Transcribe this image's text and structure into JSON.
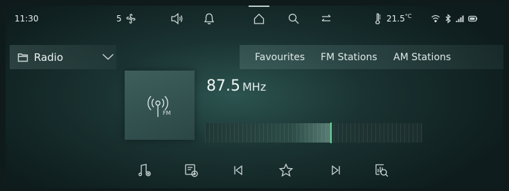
{
  "status_bar": {
    "time": "11:30",
    "fan_level": "5",
    "temperature": "21.5",
    "temperature_unit": "°C",
    "icons": [
      "fan-icon",
      "volume-icon",
      "bell-icon",
      "home-icon",
      "search-icon",
      "return-icon",
      "thermometer-icon",
      "wifi-icon",
      "bluetooth-icon",
      "signal-icon",
      "battery-icon"
    ]
  },
  "source_selector": {
    "label": "Radio"
  },
  "tabs": [
    {
      "label": "Favourites"
    },
    {
      "label": "FM Stations"
    },
    {
      "label": "AM Stations"
    }
  ],
  "station": {
    "frequency": "87.5",
    "unit": "MHz",
    "band_badge": "FM"
  },
  "tuner": {
    "position_fraction": 0.58,
    "needle_color": "#5fd39b"
  },
  "controls": [
    {
      "icon": "music-settings-icon"
    },
    {
      "icon": "playlist-add-icon"
    },
    {
      "icon": "previous-icon"
    },
    {
      "icon": "favourite-star-icon"
    },
    {
      "icon": "next-icon"
    },
    {
      "icon": "station-search-icon"
    }
  ],
  "colors": {
    "accent": "#5fd39b",
    "background": "#0e1c1d"
  }
}
